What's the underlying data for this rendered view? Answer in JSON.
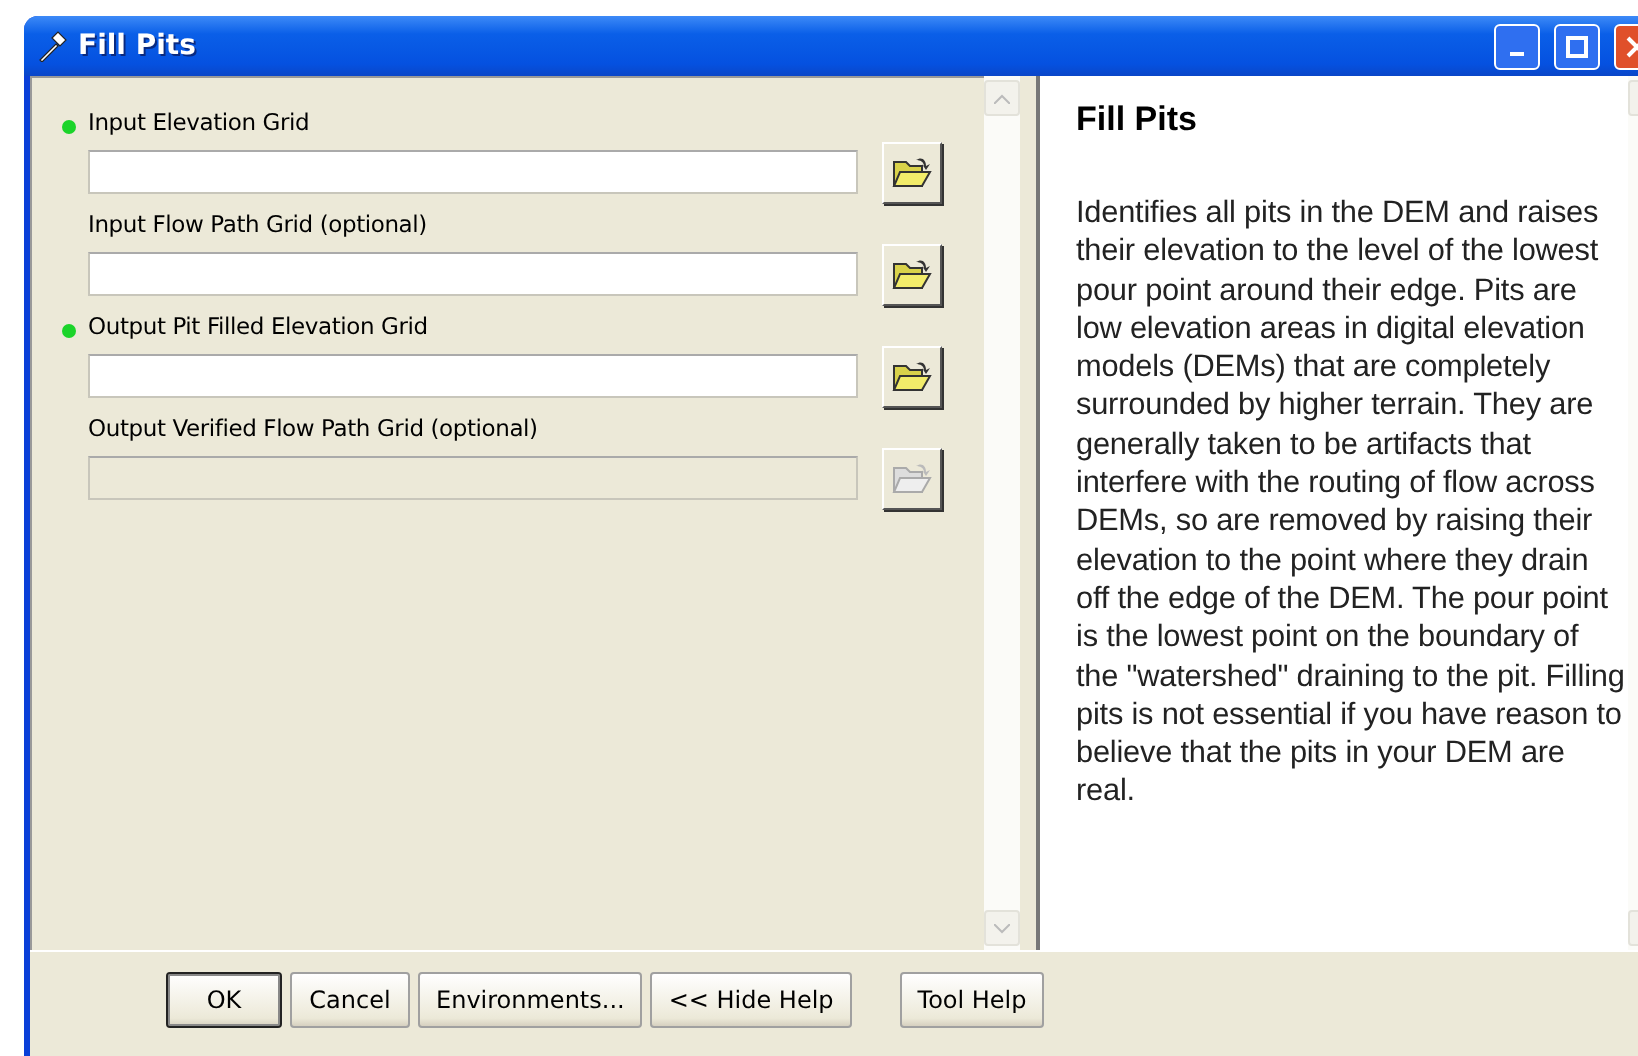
{
  "window": {
    "title": "Fill Pits"
  },
  "parameters": [
    {
      "label": "Input Elevation Grid",
      "required": true,
      "disabled": false
    },
    {
      "label": "Input Flow Path Grid (optional)",
      "required": false,
      "disabled": false
    },
    {
      "label": "Output Pit Filled Elevation Grid",
      "required": true,
      "disabled": false
    },
    {
      "label": "Output Verified Flow Path Grid (optional)",
      "required": false,
      "disabled": true
    }
  ],
  "help": {
    "title": "Fill Pits",
    "text": "Identifies all pits in the DEM and raises their elevation to the level of the lowest pour point around their edge. Pits are low elevation areas in digital elevation models (DEMs) that are completely surrounded by higher terrain. They are generally taken to be artifacts that interfere with the routing of flow across DEMs, so are removed by raising their elevation to the point where they drain off the edge of the DEM. The pour point is the lowest point on the boundary of the \"watershed\" draining to the pit. Filling pits is not essential if you have reason to believe that the pits in your DEM are real."
  },
  "buttons": [
    {
      "label": "OK",
      "default": true
    },
    {
      "label": "Cancel",
      "default": false
    },
    {
      "label": "Environments...",
      "default": false
    },
    {
      "label": "<< Hide Help",
      "default": false
    },
    {
      "label": "Tool Help",
      "default": false
    }
  ]
}
